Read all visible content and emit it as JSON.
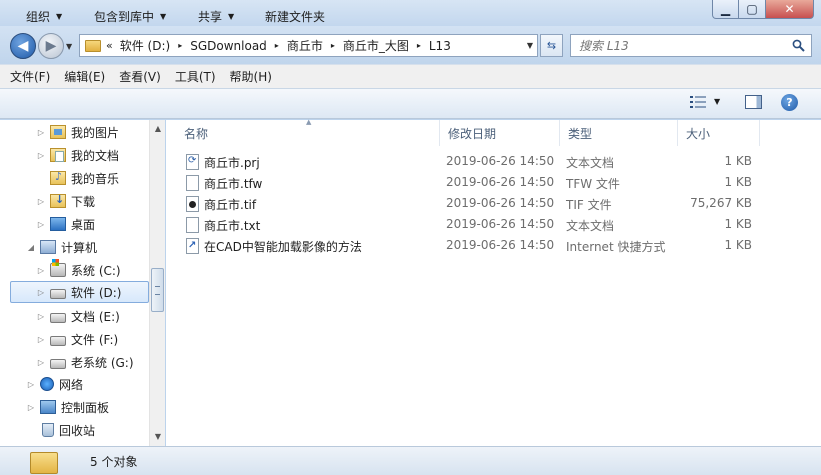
{
  "window": {
    "minimize": "▁",
    "maximize": "▢",
    "close": "✕"
  },
  "navigation": {
    "back_icon": "back-arrow-icon",
    "forward_icon": "forward-arrow-icon"
  },
  "address": {
    "overflow": "«",
    "crumbs": [
      "软件 (D:)",
      "SGDownload",
      "商丘市",
      "商丘市_大图",
      "L13"
    ],
    "separator": "▸"
  },
  "search": {
    "placeholder": "搜索 L13"
  },
  "menu": [
    "文件(F)",
    "编辑(E)",
    "查看(V)",
    "工具(T)",
    "帮助(H)"
  ],
  "commands": {
    "organize": "组织",
    "include_in_library": "包含到库中",
    "share": "共享",
    "new_folder": "新建文件夹",
    "caret": "▼",
    "help": "?"
  },
  "tree": [
    {
      "label": "我的图片",
      "arrow": "▷",
      "icon": "pictures-icon"
    },
    {
      "label": "我的文档",
      "arrow": "▷",
      "icon": "documents-icon"
    },
    {
      "label": "我的音乐",
      "arrow": "",
      "icon": "music-icon"
    },
    {
      "label": "下载",
      "arrow": "▷",
      "icon": "downloads-icon"
    },
    {
      "label": "桌面",
      "arrow": "▷",
      "icon": "desktop-icon"
    },
    {
      "label": "计算机",
      "arrow": "◢",
      "icon": "computer-icon"
    },
    {
      "label": "系统 (C:)",
      "arrow": "▷",
      "icon": "system-drive-icon"
    },
    {
      "label": "软件 (D:)",
      "arrow": "▷",
      "icon": "drive-icon",
      "selected": true
    },
    {
      "label": "文档 (E:)",
      "arrow": "▷",
      "icon": "drive-icon"
    },
    {
      "label": "文件 (F:)",
      "arrow": "▷",
      "icon": "drive-icon"
    },
    {
      "label": "老系统 (G:)",
      "arrow": "▷",
      "icon": "drive-icon"
    },
    {
      "label": "网络",
      "arrow": "▷",
      "icon": "network-icon"
    },
    {
      "label": "控制面板",
      "arrow": "▷",
      "icon": "control-panel-icon"
    },
    {
      "label": "回收站",
      "arrow": "",
      "icon": "recycle-bin-icon"
    }
  ],
  "columns": {
    "name": "名称",
    "date": "修改日期",
    "type": "类型",
    "size": "大小"
  },
  "files": [
    {
      "name": "商丘市.prj",
      "date": "2019-06-26 14:50",
      "type": "文本文档",
      "size": "1 KB",
      "icon": "prj-file-icon"
    },
    {
      "name": "商丘市.tfw",
      "date": "2019-06-26 14:50",
      "type": "TFW 文件",
      "size": "1 KB",
      "icon": "tfw-file-icon"
    },
    {
      "name": "商丘市.tif",
      "date": "2019-06-26 14:50",
      "type": "TIF 文件",
      "size": "75,267 KB",
      "icon": "tif-file-icon"
    },
    {
      "name": "商丘市.txt",
      "date": "2019-06-26 14:50",
      "type": "文本文档",
      "size": "1 KB",
      "icon": "txt-file-icon"
    },
    {
      "name": "在CAD中智能加载影像的方法",
      "date": "2019-06-26 14:50",
      "type": "Internet 快捷方式",
      "size": "1 KB",
      "icon": "internet-shortcut-icon"
    }
  ],
  "status": {
    "item_count": "5 个对象"
  },
  "colors": {
    "accent": "#2b5797",
    "selection": "#d7e8fb",
    "chrome": "#bcd3ec"
  }
}
